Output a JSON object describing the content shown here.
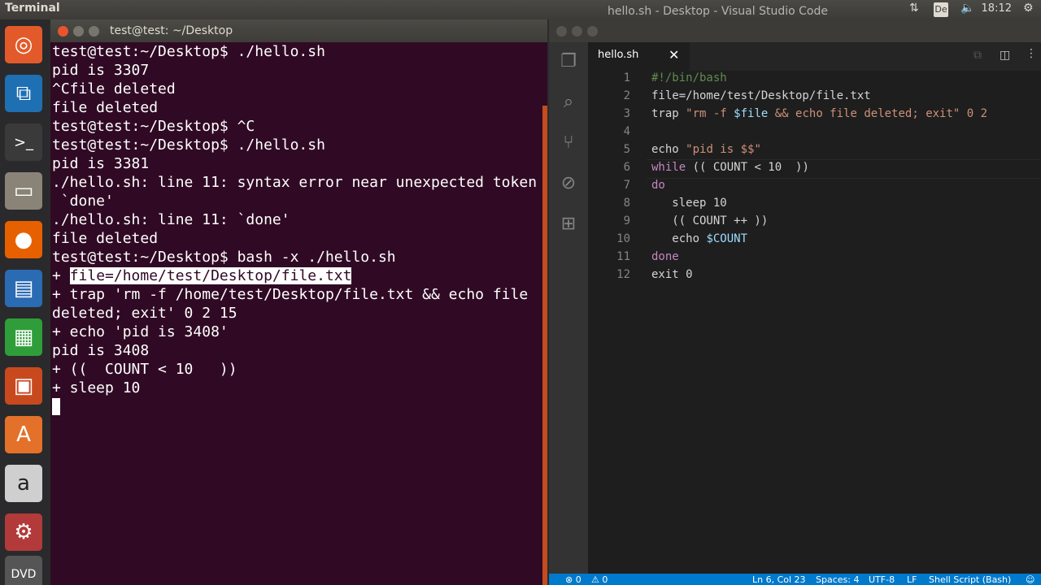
{
  "top_panel": {
    "app_title": "Terminal",
    "keyboard": "De",
    "clock": "18:12"
  },
  "terminal": {
    "title": "test@test: ~/Desktop",
    "lines": [
      "test@test:~/Desktop$ ./hello.sh",
      "pid is 3307",
      "^Cfile deleted",
      "file deleted",
      "test@test:~/Desktop$ ^C",
      "test@test:~/Desktop$ ./hello.sh",
      "pid is 3381",
      "./hello.sh: line 11: syntax error near unexpected token",
      " `done'",
      "./hello.sh: line 11: `done'",
      "file deleted",
      "test@test:~/Desktop$ bash -x ./hello.sh"
    ],
    "selected_prefix": "+ ",
    "selected_text": "file=/home/test/Desktop/file.txt",
    "lines_after": [
      "+ trap 'rm -f /home/test/Desktop/file.txt && echo file",
      "deleted; exit' 0 2 15",
      "+ echo 'pid is 3408'",
      "pid is 3408",
      "+ ((  COUNT < 10   ))",
      "+ sleep 10"
    ]
  },
  "vscode": {
    "title": "hello.sh - Desktop - Visual Studio Code",
    "tab": "hello.sh",
    "code": {
      "l1": "#!/bin/bash",
      "l2": "file=/home/test/Desktop/file.txt",
      "l3a": "trap ",
      "l3b": "\"rm -f ",
      "l3c": "$file",
      "l3d": " && echo file deleted; exit\" 0 2",
      "l5a": "echo ",
      "l5b": "\"pid is $$\"",
      "l6a": "while",
      "l6b": " (( COUNT < 10  ))",
      "l7": "do",
      "l8": "   sleep 10",
      "l9": "   (( COUNT ++ ))",
      "l10a": "   echo ",
      "l10b": "$COUNT",
      "l11": "done",
      "l12": "exit 0"
    },
    "line_numbers": [
      "1",
      "2",
      "3",
      "4",
      "5",
      "6",
      "7",
      "8",
      "9",
      "10",
      "11",
      "12"
    ],
    "status": {
      "errors": "⊗ 0",
      "warnings": "⚠ 0",
      "position": "Ln 6, Col 23",
      "spaces": "Spaces: 4",
      "encoding": "UTF-8",
      "eol": "LF",
      "language": "Shell Script (Bash)"
    }
  }
}
